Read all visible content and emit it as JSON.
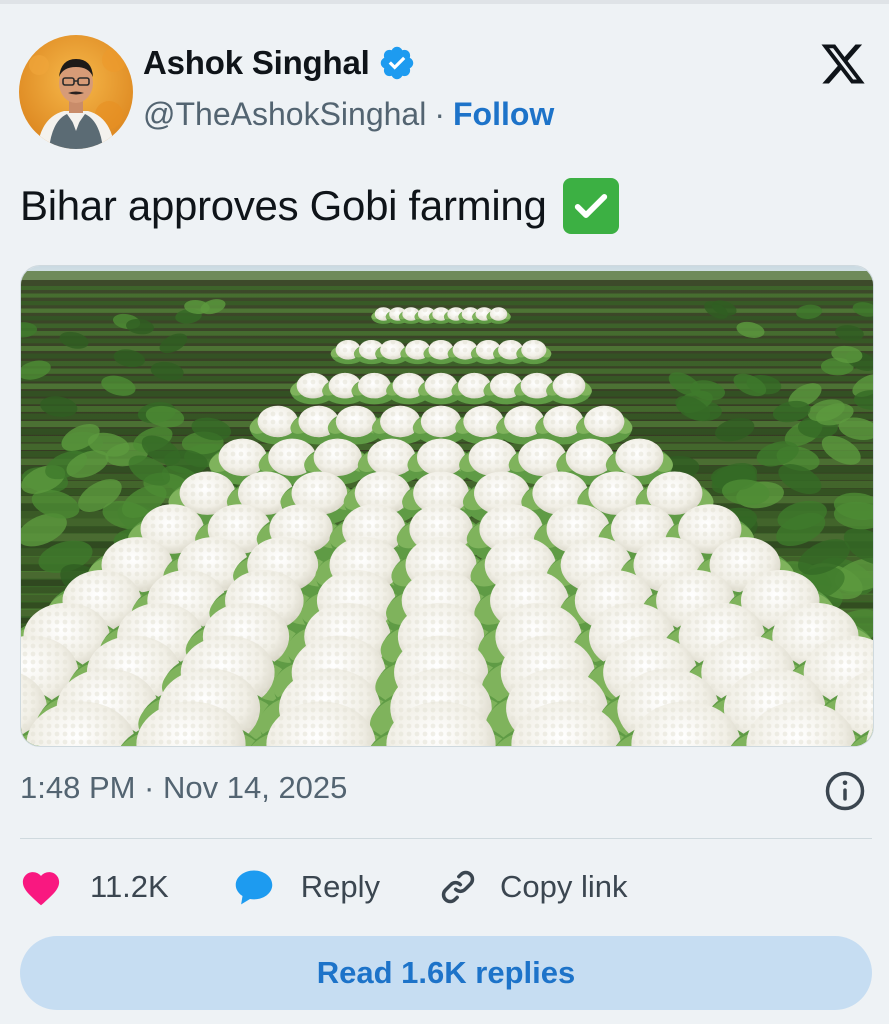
{
  "author": {
    "name": "Ashok Singhal",
    "handle": "@TheAshokSinghal",
    "separator": "·",
    "follow_label": "Follow",
    "verified": true
  },
  "tweet": {
    "text": "Bihar approves Gobi farming",
    "emoji": "check-mark-button",
    "timestamp": "1:48 PM · Nov 14, 2025"
  },
  "media": {
    "subject": "cauliflower-field"
  },
  "actions": {
    "likes_count": "11.2K",
    "reply_label": "Reply",
    "copy_link_label": "Copy link"
  },
  "read_replies_label": "Read 1.6K replies",
  "icons": {
    "like": "heart-icon",
    "reply": "speech-bubble-icon",
    "copy": "link-icon",
    "info": "info-icon",
    "brand": "x-logo"
  },
  "colors": {
    "link_blue": "#1d73c9",
    "verified_blue": "#1d9bf0",
    "heart_pink": "#f91880",
    "button_bg": "#c6ddf2",
    "check_green": "#3cb043"
  }
}
